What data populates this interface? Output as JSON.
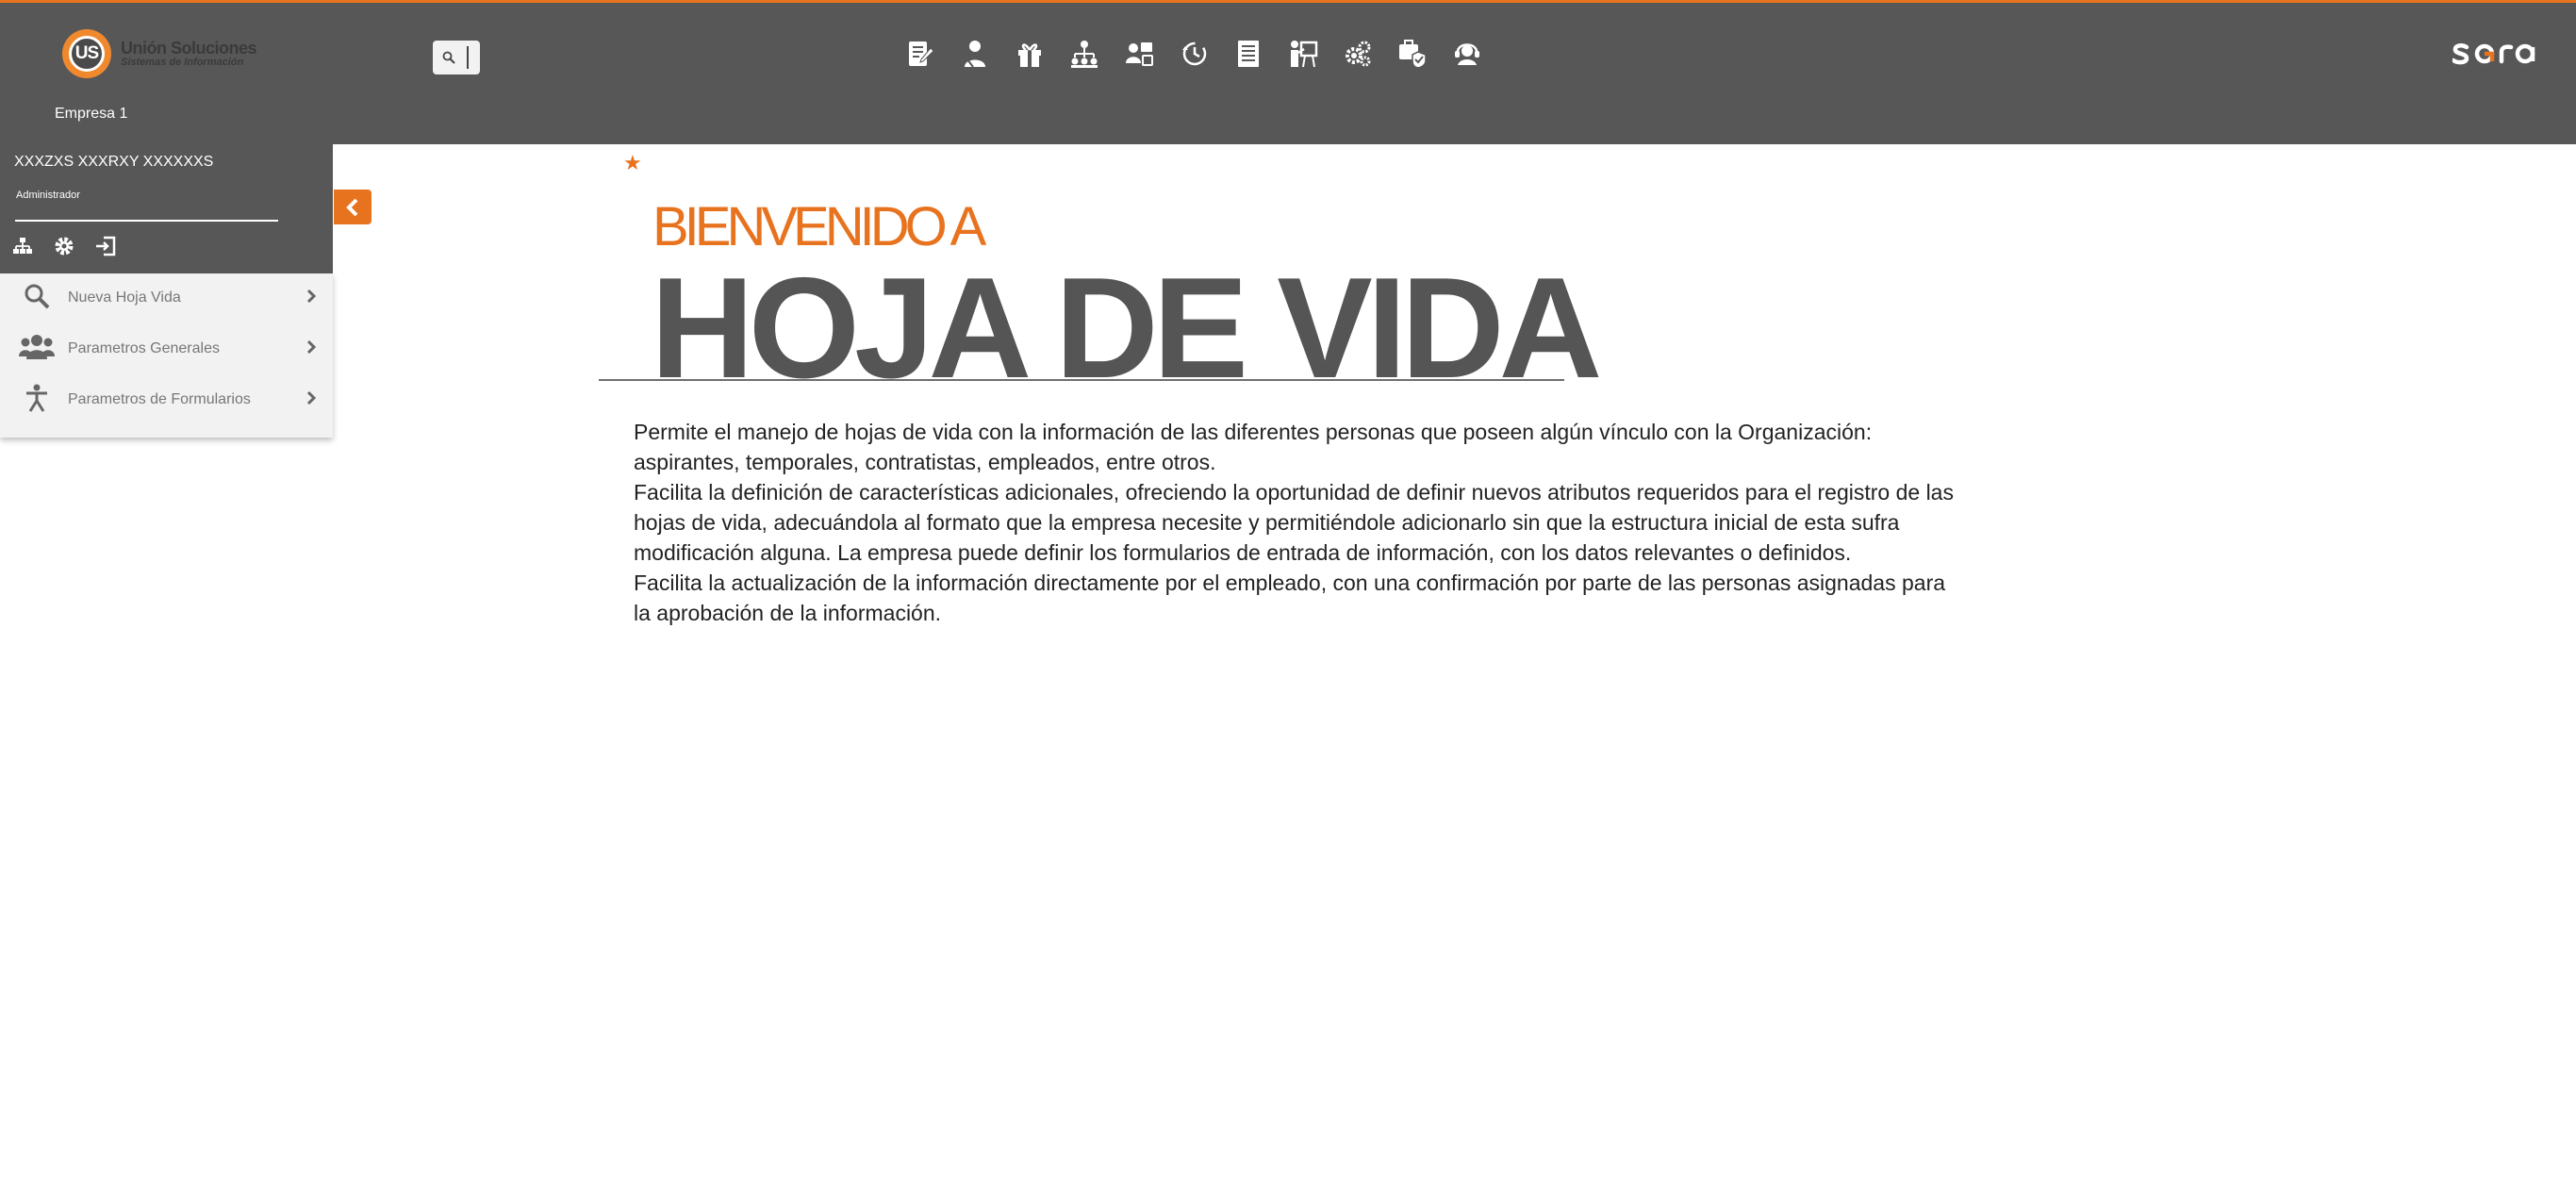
{
  "header": {
    "logo": {
      "letters": "US",
      "name": "Unión Soluciones",
      "subtitle": "Sistemas de Información"
    },
    "company": "Empresa 1",
    "search": {
      "icon": "search-icon"
    },
    "nav_icons": [
      "document-edit-icon",
      "employee-icon",
      "gift-icon",
      "hierarchy-icon",
      "user-transfer-icon",
      "clock-history-icon",
      "report-list-icon",
      "training-icon",
      "gears-icon",
      "security-badge-icon",
      "support-agent-icon"
    ],
    "brand": "sara"
  },
  "user": {
    "name": "XXXZXS XXXRXY XXXXXXS",
    "role": "Administrador",
    "actions": [
      "sitemap-icon",
      "settings-icon",
      "logout-icon"
    ]
  },
  "sidebar": {
    "items": [
      {
        "label": "Nueva Hoja Vida",
        "icon": "search-icon"
      },
      {
        "label": "Parametros Generales",
        "icon": "users-icon"
      },
      {
        "label": "Parametros de Formularios",
        "icon": "person-icon"
      }
    ]
  },
  "main": {
    "welcome_small": "BIENVENIDO A",
    "welcome_big": "HOJA DE VIDA",
    "paragraphs": [
      "Permite el manejo de hojas de vida con la información de las diferentes personas que poseen algún vínculo con la Organización: aspirantes, temporales, contratistas, empleados, entre otros.",
      "Facilita la definición de características adicionales, ofreciendo la oportunidad de definir nuevos atributos requeridos para el registro de las hojas de vida, adecuándola al formato que la empresa necesite y permitiéndole adicionarlo sin que la estructura inicial de esta sufra modificación alguna. La empresa puede definir los formularios de entrada de información, con los datos relevantes o definidos.",
      "Facilita la actualización de la información directamente por el empleado, con una confirmación por parte de las personas asignadas para la aprobación de la información."
    ]
  },
  "colors": {
    "accent": "#e8731f",
    "dark": "#575757",
    "menu_bg": "#f2f2f2"
  }
}
